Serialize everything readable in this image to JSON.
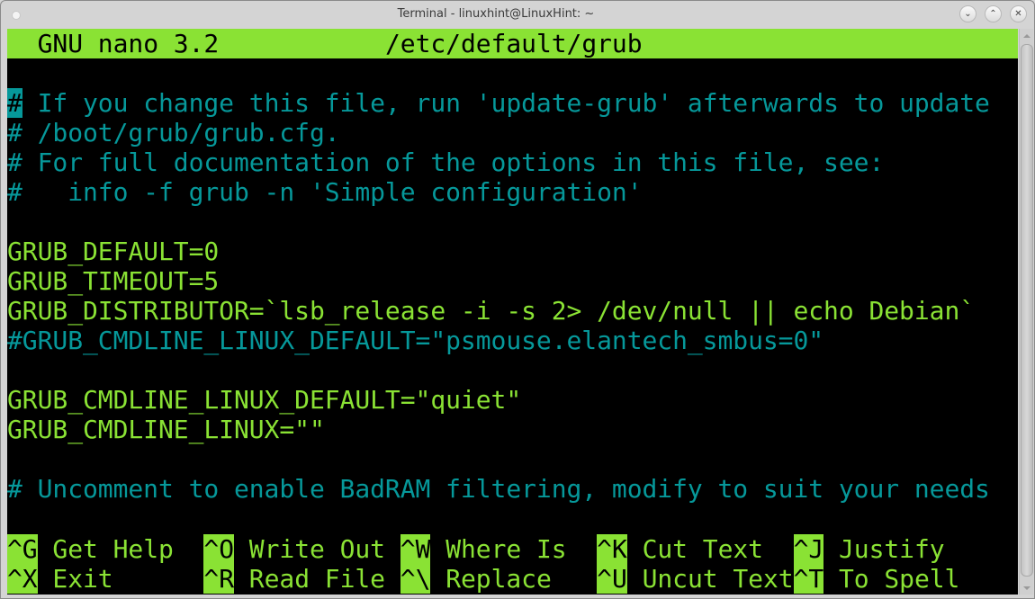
{
  "window": {
    "title": "Terminal - linuxhint@LinuxHint: ~",
    "buttons": {
      "minimize": "⌄",
      "maximize": "⌃",
      "close": "✕"
    }
  },
  "nano": {
    "version_label": "GNU nano 3.2",
    "filename": "/etc/default/grub",
    "cursor_char": "#",
    "lines": [
      {
        "type": "comment",
        "text": " If you change this file, run 'update-grub' afterwards to update"
      },
      {
        "type": "comment",
        "text": "# /boot/grub/grub.cfg."
      },
      {
        "type": "comment",
        "text": "# For full documentation of the options in this file, see:"
      },
      {
        "type": "comment",
        "text": "#   info -f grub -n 'Simple configuration'"
      },
      {
        "type": "blank",
        "text": ""
      },
      {
        "type": "config",
        "text": "GRUB_DEFAULT=0"
      },
      {
        "type": "config",
        "text": "GRUB_TIMEOUT=5"
      },
      {
        "type": "config",
        "text": "GRUB_DISTRIBUTOR=`lsb_release -i -s 2> /dev/null || echo Debian`"
      },
      {
        "type": "comment",
        "text": "#GRUB_CMDLINE_LINUX_DEFAULT=\"psmouse.elantech_smbus=0\""
      },
      {
        "type": "blank",
        "text": ""
      },
      {
        "type": "config",
        "text": "GRUB_CMDLINE_LINUX_DEFAULT=\"quiet\""
      },
      {
        "type": "config",
        "text": "GRUB_CMDLINE_LINUX=\"\""
      },
      {
        "type": "blank",
        "text": ""
      },
      {
        "type": "comment",
        "text": "# Uncomment to enable BadRAM filtering, modify to suit your needs"
      }
    ],
    "shortcuts_row1": [
      {
        "key": "^G",
        "label": " Get Help  "
      },
      {
        "key": "^O",
        "label": " Write Out "
      },
      {
        "key": "^W",
        "label": " Where Is  "
      },
      {
        "key": "^K",
        "label": " Cut Text  "
      },
      {
        "key": "^J",
        "label": " Justify"
      }
    ],
    "shortcuts_row2": [
      {
        "key": "^X",
        "label": " Exit      "
      },
      {
        "key": "^R",
        "label": " Read File "
      },
      {
        "key": "^\\",
        "label": " Replace   "
      },
      {
        "key": "^U",
        "label": " Uncut Text"
      },
      {
        "key": "^T",
        "label": " To Spell"
      }
    ]
  },
  "colors": {
    "accent_green": "#8ae234",
    "comment_teal": "#06989a",
    "background": "#000000"
  }
}
